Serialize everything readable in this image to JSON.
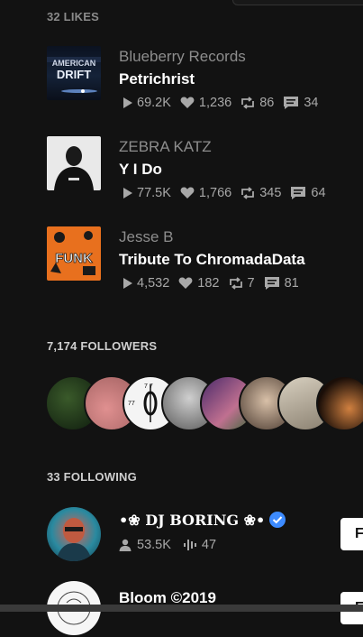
{
  "likes": {
    "title": "32 LIKES",
    "tracks": [
      {
        "artist": "Blueberry Records",
        "title": "Petrichrist",
        "plays": "69.2K",
        "likes": "1,236",
        "reposts": "86",
        "comments": "34",
        "art_text": "AMERICAN DRIFT"
      },
      {
        "artist": "ZEBRA KATZ",
        "title": "Y I Do",
        "plays": "77.5K",
        "likes": "1,766",
        "reposts": "345",
        "comments": "64"
      },
      {
        "artist": "Jesse B",
        "title": "Tribute To ChromadaData",
        "plays": "4,532",
        "likes": "182",
        "reposts": "7",
        "comments": "81",
        "art_text": "FUNK"
      }
    ]
  },
  "followers": {
    "title": "7,174 FOLLOWERS",
    "avatar_colors": [
      "#1f3a22",
      "#c78080",
      "#f2f2f2",
      "#8c8c8c",
      "#7a4a8a",
      "#6a5a4a",
      "#b8b0a0",
      "#4a3020"
    ]
  },
  "following": {
    "title": "33 FOLLOWING",
    "users": [
      {
        "name": "•❀ DJ BORING ❀•",
        "verified": true,
        "followers": "53.5K",
        "tracks": "47",
        "button_label": "F"
      },
      {
        "name": "Bloom ©2019",
        "verified": false,
        "button_label": "F"
      }
    ]
  },
  "colors": {
    "background": "#121212",
    "muted": "#8d8d8d",
    "verified": "#3d8bff"
  }
}
